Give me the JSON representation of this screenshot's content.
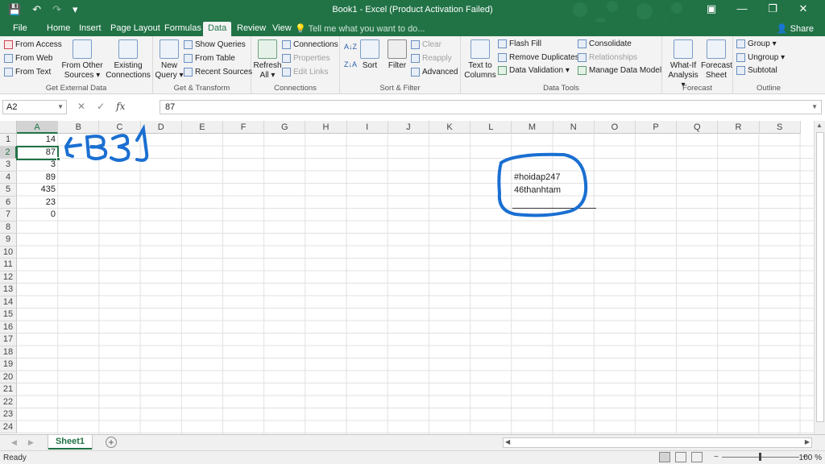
{
  "window": {
    "title": "Book1 - Excel (Product Activation Failed)",
    "minimize": "—",
    "restore": "❐",
    "close": "✕",
    "ribbon_display": "▣"
  },
  "qat": {
    "save": "💾",
    "undo": "↶",
    "redo": "↷",
    "customize": "▾"
  },
  "tabs": [
    {
      "label": "File"
    },
    {
      "label": "Home"
    },
    {
      "label": "Insert"
    },
    {
      "label": "Page Layout"
    },
    {
      "label": "Formulas"
    },
    {
      "label": "Data"
    },
    {
      "label": "Review"
    },
    {
      "label": "View"
    }
  ],
  "active_tab": "Data",
  "tell_me": "Tell me what you want to do...",
  "share": "Share",
  "ribbon": {
    "get_external": {
      "label": "Get External Data",
      "from_access": "From Access",
      "from_web": "From Web",
      "from_text": "From Text",
      "from_other_1": "From Other",
      "from_other_2": "Sources ▾",
      "existing_1": "Existing",
      "existing_2": "Connections"
    },
    "get_transform": {
      "label": "Get & Transform",
      "new_query_1": "New",
      "new_query_2": "Query ▾",
      "show_queries": "Show Queries",
      "from_table": "From Table",
      "recent_sources": "Recent Sources"
    },
    "connections": {
      "label": "Connections",
      "refresh_1": "Refresh",
      "refresh_2": "All ▾",
      "connections": "Connections",
      "properties": "Properties",
      "edit_links": "Edit Links"
    },
    "sort_filter": {
      "label": "Sort & Filter",
      "sort": "Sort",
      "filter": "Filter",
      "clear": "Clear",
      "reapply": "Reapply",
      "advanced": "Advanced"
    },
    "data_tools": {
      "label": "Data Tools",
      "text_to_1": "Text to",
      "text_to_2": "Columns",
      "flash_fill": "Flash Fill",
      "remove_dup": "Remove Duplicates",
      "data_validation": "Data Validation ▾",
      "consolidate": "Consolidate",
      "relationships": "Relationships",
      "manage_model": "Manage Data Model"
    },
    "forecast": {
      "label": "Forecast",
      "whatif_1": "What-If",
      "whatif_2": "Analysis ▾",
      "sheet_1": "Forecast",
      "sheet_2": "Sheet"
    },
    "outline": {
      "label": "Outline",
      "group": "Group ▾",
      "ungroup": "Ungroup ▾",
      "subtotal": "Subtotal"
    }
  },
  "formula_bar": {
    "name_box": "A2",
    "cancel": "✕",
    "enter": "✓",
    "fx": "fx",
    "content": "87"
  },
  "columns": [
    "A",
    "B",
    "C",
    "D",
    "E",
    "F",
    "G",
    "H",
    "I",
    "J",
    "K",
    "L",
    "M",
    "N",
    "O",
    "P",
    "Q",
    "R",
    "S"
  ],
  "rows": [
    "1",
    "2",
    "3",
    "4",
    "5",
    "6",
    "7",
    "8",
    "9",
    "10",
    "11",
    "12",
    "13",
    "14",
    "15",
    "16",
    "17",
    "18",
    "19",
    "20",
    "21",
    "22",
    "23",
    "24"
  ],
  "cells_col_a": [
    "14",
    "87",
    "3",
    "89",
    "435",
    "23",
    "0"
  ],
  "note": {
    "line1": "#hoidap247",
    "line2": "46thanhtam"
  },
  "annotation_colors": {
    "pen": "#1a6fd1"
  },
  "sheet": {
    "tab": "Sheet1",
    "add": "+"
  },
  "status": {
    "ready": "Ready",
    "zoom_minus": "−",
    "zoom_plus": "+",
    "zoom": "100 %"
  },
  "colors": {
    "accent": "#217346"
  }
}
